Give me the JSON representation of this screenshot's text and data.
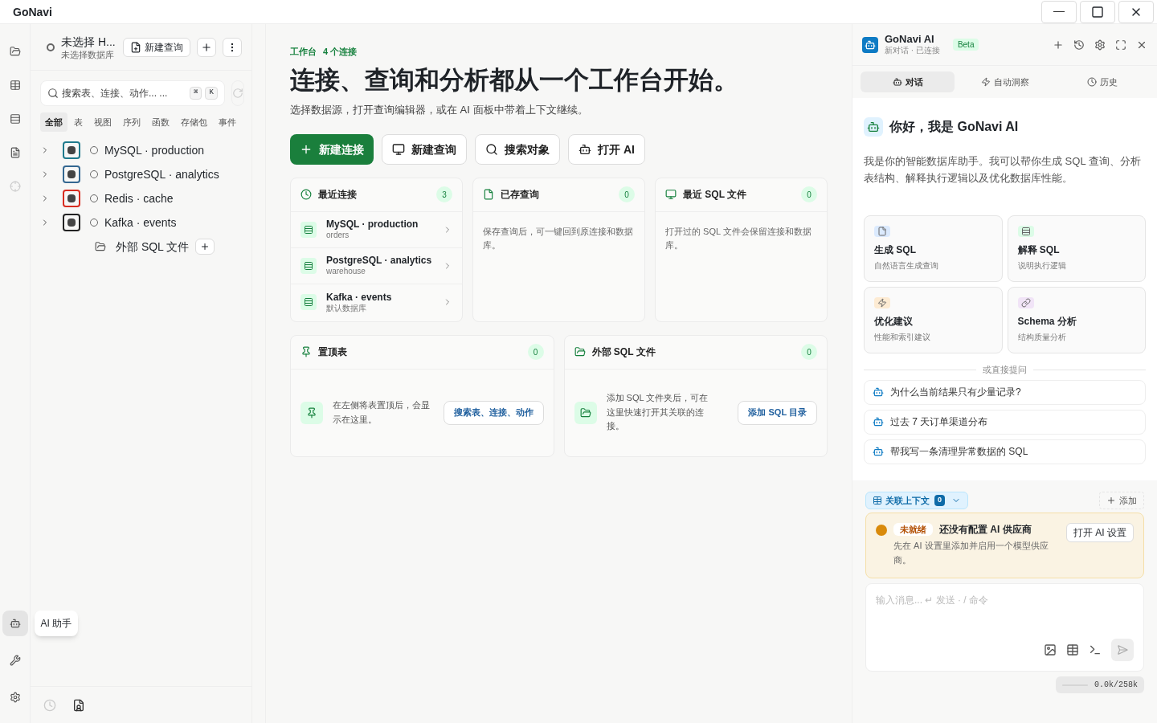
{
  "window": {
    "title": "GoNavi"
  },
  "rail": {
    "items": [
      {
        "kind": "folder",
        "selected": false
      },
      {
        "kind": "table",
        "selected": false
      },
      {
        "kind": "list",
        "selected": false
      },
      {
        "kind": "file",
        "selected": false
      },
      {
        "kind": "target",
        "selected": false
      }
    ],
    "bottom": [
      {
        "kind": "bot",
        "selected": true
      },
      {
        "kind": "wrench",
        "selected": false
      },
      {
        "kind": "settings",
        "selected": false
      }
    ],
    "tooltip": "AI 助手"
  },
  "sidebar": {
    "connection_title": "未选择 H...",
    "connection_subtitle": "未选择数据库",
    "new_query": "新建查询",
    "search_placeholder": "搜索表、连接、动作... ...",
    "shortcut": [
      "⌘",
      "K"
    ],
    "filters": [
      {
        "label": "全部",
        "selected": true
      },
      {
        "label": "表",
        "selected": false
      },
      {
        "label": "视图",
        "selected": false
      },
      {
        "label": "序列",
        "selected": false
      },
      {
        "label": "函数",
        "selected": false
      },
      {
        "label": "存储包",
        "selected": false
      },
      {
        "label": "事件",
        "selected": false
      }
    ],
    "tree": [
      {
        "label": "MySQL · production",
        "kind": "mysql",
        "expanded": false
      },
      {
        "label": "PostgreSQL · analytics",
        "kind": "postgres",
        "expanded": false
      },
      {
        "label": "Redis · cache",
        "kind": "redis",
        "expanded": false
      },
      {
        "label": "Kafka · events",
        "kind": "kafka",
        "expanded": false
      }
    ],
    "external": "外部 SQL 文件"
  },
  "main": {
    "eyebrow": "工作台",
    "connection_count": "4 个连接",
    "heading": "连接、查询和分析都从一个工作台开始。",
    "subheading": "选择数据源，打开查询编辑器，或在 AI 面板中带着上下文继续。",
    "actions": [
      {
        "label": "新建连接",
        "kind": "plus",
        "primary": true
      },
      {
        "label": "新建查询",
        "kind": "monitor",
        "primary": false
      },
      {
        "label": "搜索对象",
        "kind": "search",
        "primary": false
      },
      {
        "label": "打开 AI",
        "kind": "bot",
        "primary": false
      }
    ],
    "cards": [
      {
        "title": "最近连接",
        "kind": "clock",
        "count": "3",
        "items": [
          {
            "title": "MySQL · production",
            "subtitle": "orders"
          },
          {
            "title": "PostgreSQL · analytics",
            "subtitle": "warehouse"
          },
          {
            "title": "Kafka · events",
            "subtitle": "默认数据库"
          }
        ]
      },
      {
        "title": "已存查询",
        "kind": "file",
        "count": "0",
        "empty": "保存查询后，可一键回到原连接和数据库。"
      },
      {
        "title": "最近 SQL 文件",
        "kind": "monitor",
        "count": "0",
        "empty": "打开过的 SQL 文件会保留连接和数据库。"
      }
    ],
    "wide_cards": [
      {
        "title": "置顶表",
        "kind": "pin",
        "count": "0",
        "empty": "在左侧将表置顶后，会显示在这里。",
        "action": "搜索表、连接、动作"
      },
      {
        "title": "外部 SQL 文件",
        "kind": "folder",
        "count": "0",
        "empty": "添加 SQL 文件夹后，可在这里快速打开其关联的连接。",
        "action": "添加 SQL 目录"
      }
    ]
  },
  "ai_panel": {
    "title": "GoNavi AI",
    "badge": "Beta",
    "subtitle": "新对话 · 已连接",
    "tabs": [
      {
        "label": "对话",
        "kind": "bot",
        "selected": true
      },
      {
        "label": "自动洞察",
        "kind": "zap",
        "selected": false
      },
      {
        "label": "历史",
        "kind": "clock",
        "selected": false
      }
    ],
    "greeting": "你好，我是 GoNavi AI",
    "intro": "我是你的智能数据库助手。我可以帮你生成 SQL 查询、分析表结构、解释执行逻辑以及优化数据库性能。",
    "skills": [
      {
        "title": "生成 SQL",
        "subtitle": "自然语言生成查询",
        "kind": "file",
        "color": "#dbeafe"
      },
      {
        "title": "解释 SQL",
        "subtitle": "说明执行逻辑",
        "kind": "list",
        "color": "#dcfce7"
      },
      {
        "title": "优化建议",
        "subtitle": "性能和索引建议",
        "kind": "zap",
        "color": "#fdebd3"
      },
      {
        "title": "Schema 分析",
        "subtitle": "结构质量分析",
        "kind": "link",
        "color": "#f1e4f7"
      }
    ],
    "divider_label": "或直接提问",
    "prompts": [
      "为什么当前结果只有少量记录?",
      "过去 7 天订单渠道分布",
      "帮我写一条清理异常数据的 SQL"
    ],
    "context_label": "关联上下文",
    "context_count": "0",
    "add": "添加",
    "warning": {
      "tag": "未就绪",
      "title": "还没有配置 AI 供应商",
      "body": "先在 AI 设置里添加并启用一个模型供应商。",
      "action": "打开 AI 设置"
    },
    "input_placeholder": "输入消息... ↵ 发送 · / 命令",
    "tokens": "0.0k/258k"
  }
}
